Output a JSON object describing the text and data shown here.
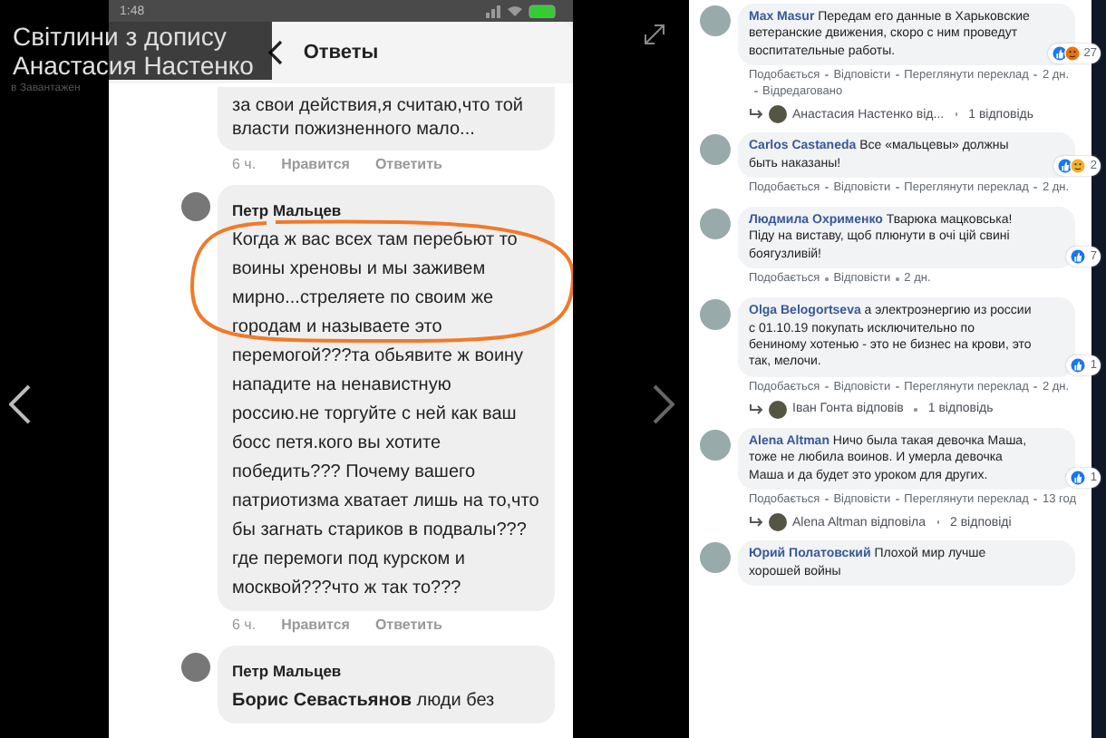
{
  "viewer": {
    "title": "Світлини з допису Анастасия Настенко",
    "subtitle": "в Завантажен"
  },
  "phone": {
    "time": "1:48",
    "header": "Ответы",
    "comments": [
      {
        "kind": "tail",
        "text": "за свои действия,я считаю,что той власти пожизненного мало...",
        "time": "6 ч.",
        "like": "Нравится",
        "reply": "Ответить"
      },
      {
        "kind": "full",
        "author": "Петр Мальцев",
        "text": "Когда ж вас всех там перебьют то воины хреновы и мы заживем мирно...стреляете по своим же городам и называете это перемогой???та обьявите ж воину нападите на ненавистную россию.не торгуйте с ней как ваш босс петя.кого вы хотите победить??? Почему вашего патриотизма хватает лишь на то,что бы загнать стариков в подвалы???где перемоги под курском и москвой???что ж так то???",
        "time": "6 ч.",
        "like": "Нравится",
        "reply": "Ответить",
        "circled": true
      },
      {
        "kind": "full",
        "author": "Петр Мальцев",
        "text": "**Борис Севастьянов** люди без",
        "circled": false
      }
    ]
  },
  "comments": [
    {
      "author": "Max Masur",
      "text": "Передам его данные в Харьковские ветеранские движения, скоро с ним проведут воспитательные работы.",
      "reactions": [
        {
          "kind": "like"
        },
        {
          "kind": "angry"
        }
      ],
      "count": "27",
      "actions": [
        "Подобається",
        "Відповісти",
        "Переглянути переклад"
      ],
      "time": "2 дн.",
      "edited": "Відредаговано",
      "reply": {
        "label": "Анастасия Настенко від...",
        "count": "1 відповідь"
      }
    },
    {
      "author": "Carlos Castaneda",
      "text": "Все «мальцевы» должны быть наказаны!",
      "reactions": [
        {
          "kind": "like"
        },
        {
          "kind": "haha"
        }
      ],
      "count": "2",
      "actions": [
        "Подобається",
        "Відповісти",
        "Переглянути переклад"
      ],
      "time": "2 дн."
    },
    {
      "author": "Людмила Охрименко",
      "text": "Тварюка мацковська! Піду на виставу, щоб плюнути в очі цій свині боягузливій!",
      "reactions": [
        {
          "kind": "like"
        }
      ],
      "count": "7",
      "actions": [
        "Подобається",
        "Відповісти"
      ],
      "time": "2 дн."
    },
    {
      "author": "Olga Belogortseva",
      "text": "а электроэнергию из россии с 01.10.19 покупать исключительно по бениному хотенью - это не бизнес на крови, это так, мелочи.",
      "reactions": [
        {
          "kind": "like"
        }
      ],
      "count": "1",
      "actions": [
        "Подобається",
        "Відповісти",
        "Переглянути переклад"
      ],
      "time": "2 дн.",
      "reply": {
        "label": "Іван Гонта відповів",
        "count": "1 відповідь"
      }
    },
    {
      "author": "Alena Altman",
      "text": "Ничо была такая девочка Маша, тоже не любила воинов. И умерла девочка Маша и да будет это уроком для других.",
      "reactions": [
        {
          "kind": "like"
        }
      ],
      "count": "1",
      "actions": [
        "Подобається",
        "Відповісти",
        "Переглянути переклад"
      ],
      "time": "13 год",
      "reply": {
        "label": "Alena Altman відповіла",
        "count": "2 відповіді"
      }
    },
    {
      "author": "Юрий Полатовский",
      "text": "Плохой мир лучше хорошей войны"
    }
  ]
}
